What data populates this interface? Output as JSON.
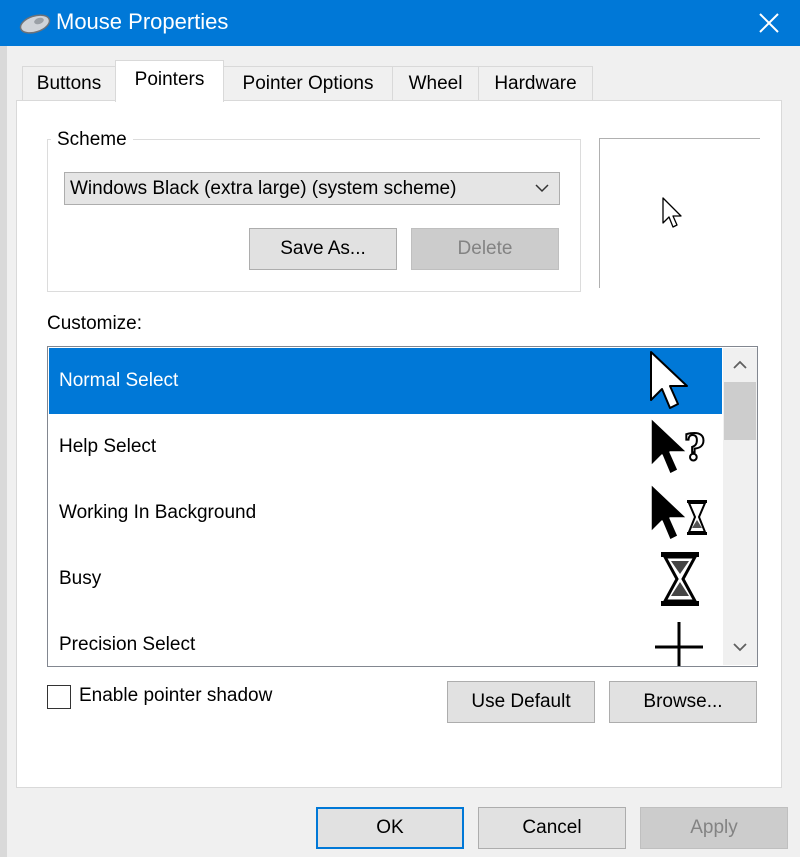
{
  "window": {
    "title": "Mouse Properties"
  },
  "tabs": [
    {
      "label": "Buttons",
      "active": false
    },
    {
      "label": "Pointers",
      "active": true
    },
    {
      "label": "Pointer Options",
      "active": false
    },
    {
      "label": "Wheel",
      "active": false
    },
    {
      "label": "Hardware",
      "active": false
    }
  ],
  "scheme": {
    "group_label": "Scheme",
    "selected": "Windows Black (extra large) (system scheme)",
    "save_as_label": "Save As...",
    "delete_label": "Delete"
  },
  "customize": {
    "label": "Customize:",
    "items": [
      {
        "name": "Normal Select",
        "icon": "arrow-cursor-icon",
        "selected": true
      },
      {
        "name": "Help Select",
        "icon": "help-cursor-icon",
        "selected": false
      },
      {
        "name": "Working In Background",
        "icon": "working-cursor-icon",
        "selected": false
      },
      {
        "name": "Busy",
        "icon": "hourglass-cursor-icon",
        "selected": false
      },
      {
        "name": "Precision Select",
        "icon": "crosshair-cursor-icon",
        "selected": false
      }
    ]
  },
  "shadow": {
    "label": "Enable pointer shadow",
    "checked": false
  },
  "buttons": {
    "use_default": "Use Default",
    "browse": "Browse...",
    "ok": "OK",
    "cancel": "Cancel",
    "apply": "Apply"
  },
  "colors": {
    "accent": "#0078d7",
    "dialog_bg": "#f0f0f0",
    "disabled_text": "#838383"
  }
}
